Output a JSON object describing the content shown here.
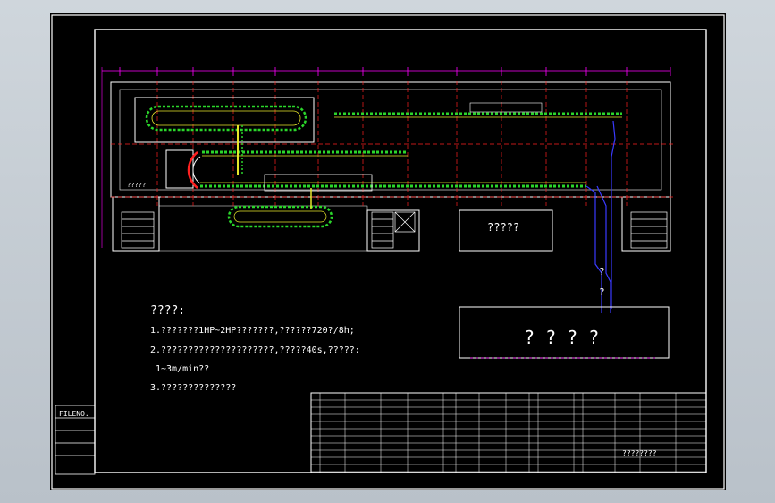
{
  "drawing": {
    "background_color": "#000000",
    "viewport_color": "#c5ccd3"
  },
  "filename_label": "FILENO.",
  "notes": {
    "heading": "????:",
    "line1": "1.???????1HP~2HP???????,??????720?/8h;",
    "line2": "2.?????????????????????,?????40s,?????:",
    "line3": "1~3m/min??",
    "line4": "3.??????????????"
  },
  "plan": {
    "room_label": "?????",
    "left_label": "?????",
    "outdoor_mark_1": "?",
    "outdoor_mark_2": "?",
    "building_label": "? ? ? ?"
  },
  "title_block": {
    "drawing_title": "????????"
  },
  "colors": {
    "conveyor_green": "#2bd62b",
    "axis_red": "#ff2020",
    "dim_magenta": "#ff00ff",
    "pipe_blue": "#3a3aff",
    "wall_white": "#ffffff",
    "track_yellow": "#e6e62a"
  }
}
